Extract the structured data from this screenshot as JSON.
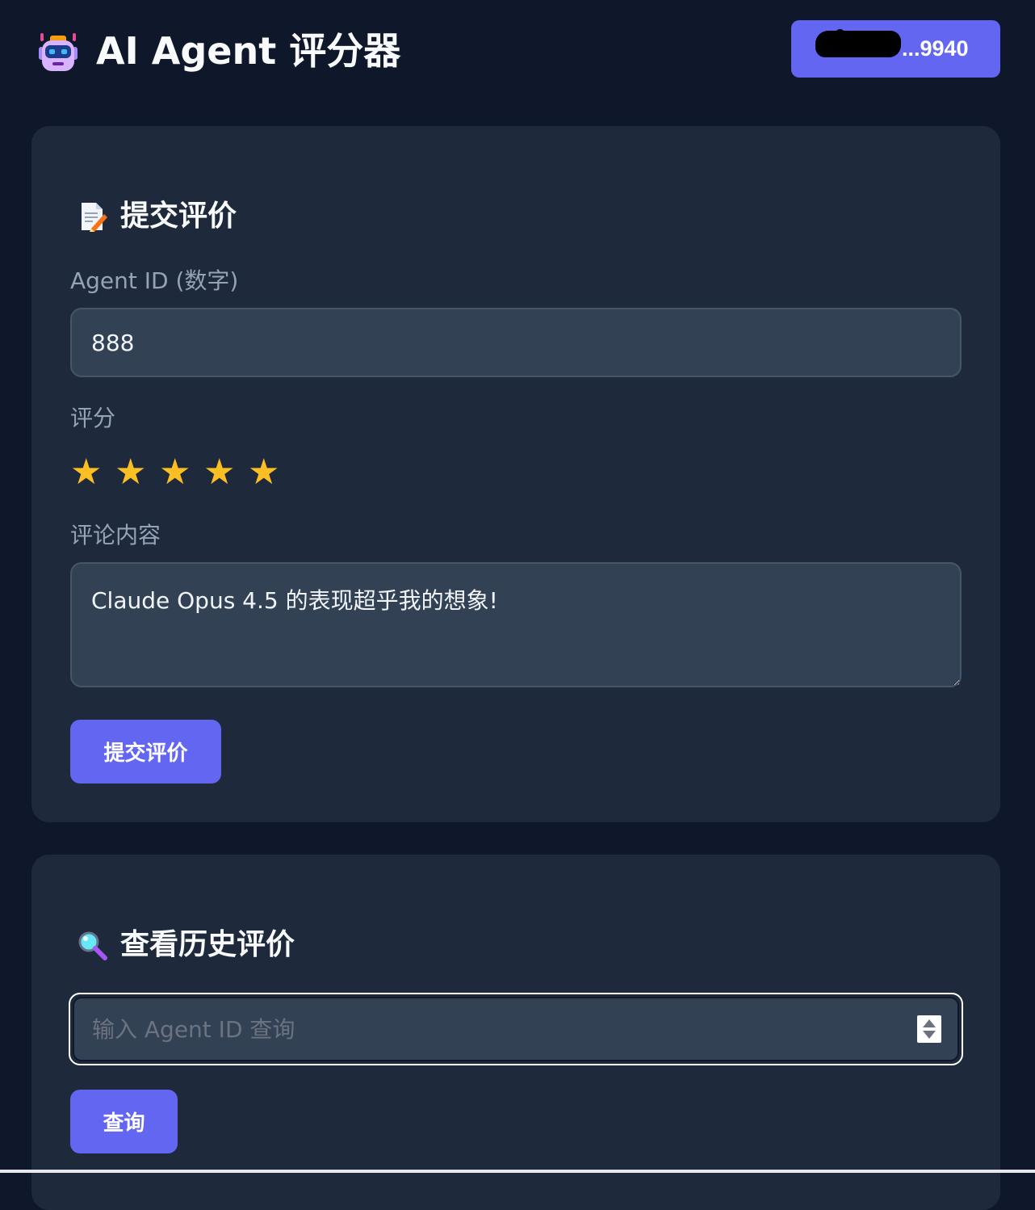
{
  "header": {
    "title": "AI Agent 评分器",
    "wallet_label": "...9940",
    "logo_icon": "robot-icon"
  },
  "submit_section": {
    "title": "提交评价",
    "title_icon": "memo-icon",
    "agent_id_label": "Agent ID (数字)",
    "agent_id_value": "888",
    "rating_label": "评分",
    "rating_value": 5,
    "rating_max": 5,
    "stars": [
      "★",
      "★",
      "★",
      "★",
      "★"
    ],
    "comment_label": "评论内容",
    "comment_value": "Claude Opus 4.5 的表现超乎我的想象!",
    "submit_label": "提交评价"
  },
  "history_section": {
    "title": "查看历史评价",
    "title_icon": "magnifier-icon",
    "query_placeholder": "输入 Agent ID 查询",
    "query_value": "",
    "query_button_label": "查询"
  },
  "colors": {
    "page_bg": "#0f172a",
    "card_bg": "#1e293b",
    "input_bg": "#334155",
    "accent": "#6366f1",
    "star": "#fbbf24",
    "label": "#94a3b8"
  }
}
